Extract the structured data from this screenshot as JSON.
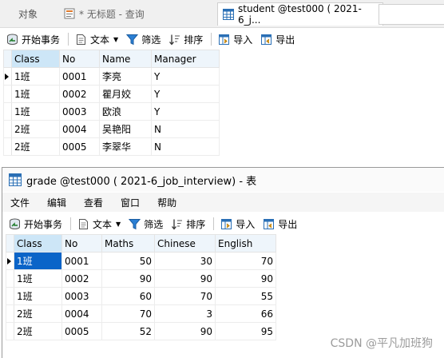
{
  "tabs": [
    {
      "label": "对象"
    },
    {
      "label": "* 无标题 - 查询"
    },
    {
      "label": "student @test000 ( 2021-6_j..."
    }
  ],
  "toolbar": {
    "begin_tx": "开始事务",
    "text": "文本",
    "filter": "筛选",
    "sort": "排序",
    "import": "导入",
    "export": "导出"
  },
  "student_grid": {
    "columns": [
      "Class",
      "No",
      "Name",
      "Manager"
    ],
    "rows": [
      [
        "1班",
        "0001",
        "李亮",
        "Y"
      ],
      [
        "1班",
        "0002",
        "瞿月姣",
        "Y"
      ],
      [
        "1班",
        "0003",
        "欧浪",
        "Y"
      ],
      [
        "2班",
        "0004",
        "吴艳阳",
        "N"
      ],
      [
        "2班",
        "0005",
        "李翠华",
        "N"
      ]
    ]
  },
  "grade_window": {
    "title": "grade @test000 ( 2021-6_job_interview) - 表",
    "menu": [
      "文件",
      "编辑",
      "查看",
      "窗口",
      "帮助"
    ],
    "columns": [
      "Class",
      "No",
      "Maths",
      "Chinese",
      "English"
    ],
    "rows": [
      [
        "1班",
        "0001",
        "50",
        "30",
        "70"
      ],
      [
        "1班",
        "0002",
        "90",
        "90",
        "90"
      ],
      [
        "1班",
        "0003",
        "60",
        "70",
        "55"
      ],
      [
        "2班",
        "0004",
        "70",
        "3",
        "66"
      ],
      [
        "2班",
        "0005",
        "52",
        "90",
        "95"
      ]
    ]
  },
  "watermark": "CSDN @平凡加班狗",
  "colors": {
    "accent": "#0a64c8",
    "header_bg": "#eef5fb"
  }
}
